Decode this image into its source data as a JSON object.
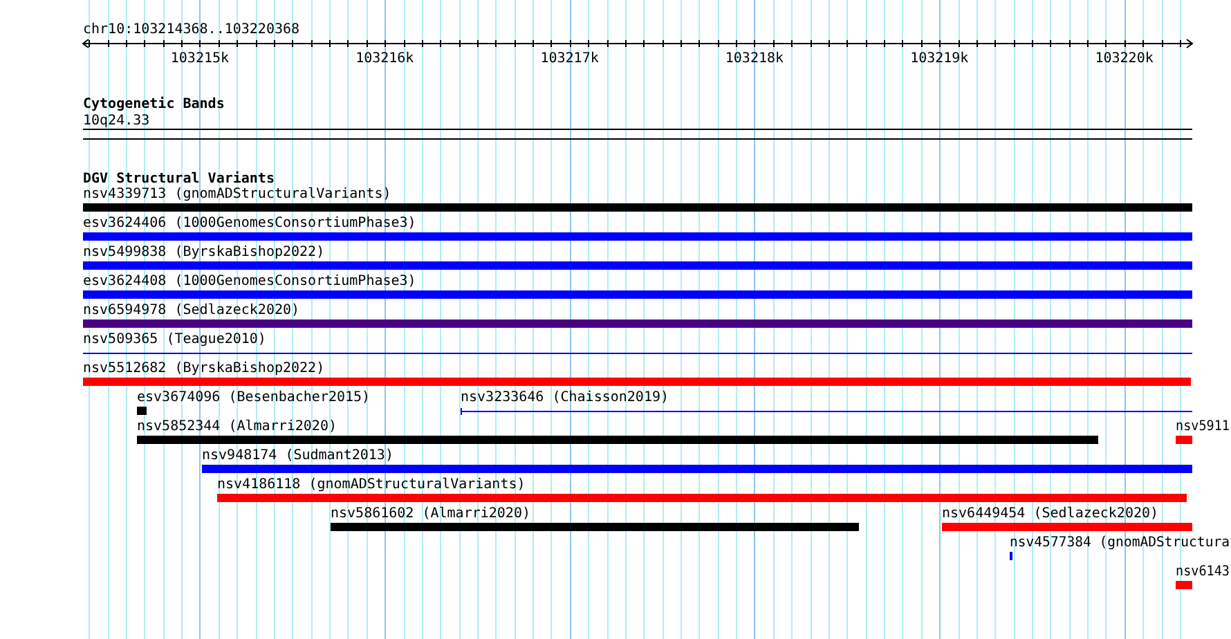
{
  "location": "chr10:103214368..103220368",
  "ruler": {
    "ticks": [
      "103215k",
      "103216k",
      "103217k",
      "103218k",
      "103219k",
      "103220k"
    ]
  },
  "cytoband_track": {
    "title": "Cytogenetic Bands",
    "band": "10q24.33"
  },
  "variant_track": {
    "title": "DGV Structural Variants",
    "rows": [
      [
        {
          "label": "nsv4339713 (gnomADStructuralVariants)",
          "color": "#000000",
          "kind": "bar"
        }
      ],
      [
        {
          "label": "esv3624406 (1000GenomesConsortiumPhase3)",
          "color": "#0000ff",
          "kind": "bar"
        }
      ],
      [
        {
          "label": "nsv5499838 (ByrskaBishop2022)",
          "color": "#0000ff",
          "kind": "bar"
        }
      ],
      [
        {
          "label": "esv3624408 (1000GenomesConsortiumPhase3)",
          "color": "#0000ff",
          "kind": "bar"
        }
      ],
      [
        {
          "label": "nsv6594978 (Sedlazeck2020)",
          "color": "#4b0082",
          "kind": "bar"
        }
      ],
      [
        {
          "label": "nsv509365 (Teague2010)",
          "color": "#0000ff",
          "kind": "line"
        }
      ],
      [
        {
          "label": "nsv5512682 (ByrskaBishop2022)",
          "color": "#ff0000",
          "kind": "bar"
        }
      ],
      [
        {
          "label": "esv3674096 (Besenbacher2015)",
          "color": "#000000",
          "kind": "bar"
        },
        {
          "label": "nsv3233646 (Chaisson2019)",
          "color": "#0000ff",
          "kind": "line"
        }
      ],
      [
        {
          "label": "nsv5852344 (Almarri2020)",
          "color": "#000000",
          "kind": "bar"
        },
        {
          "label": "nsv5911",
          "color": "#ff0000",
          "kind": "bar"
        }
      ],
      [
        {
          "label": "nsv948174 (Sudmant2013)",
          "color": "#0000ff",
          "kind": "bar"
        }
      ],
      [
        {
          "label": "nsv4186118 (gnomADStructuralVariants)",
          "color": "#ff0000",
          "kind": "bar"
        }
      ],
      [
        {
          "label": "nsv5861602 (Almarri2020)",
          "color": "#000000",
          "kind": "bar"
        },
        {
          "label": "nsv6449454 (Sedlazeck2020)",
          "color": "#ff0000",
          "kind": "bar"
        }
      ],
      [
        {
          "label": "nsv4577384 (gnomADStructura",
          "color": "#0000ff",
          "kind": "bar"
        }
      ],
      [
        {
          "label": "nsv6143",
          "color": "#ff0000",
          "kind": "bar"
        }
      ]
    ]
  }
}
